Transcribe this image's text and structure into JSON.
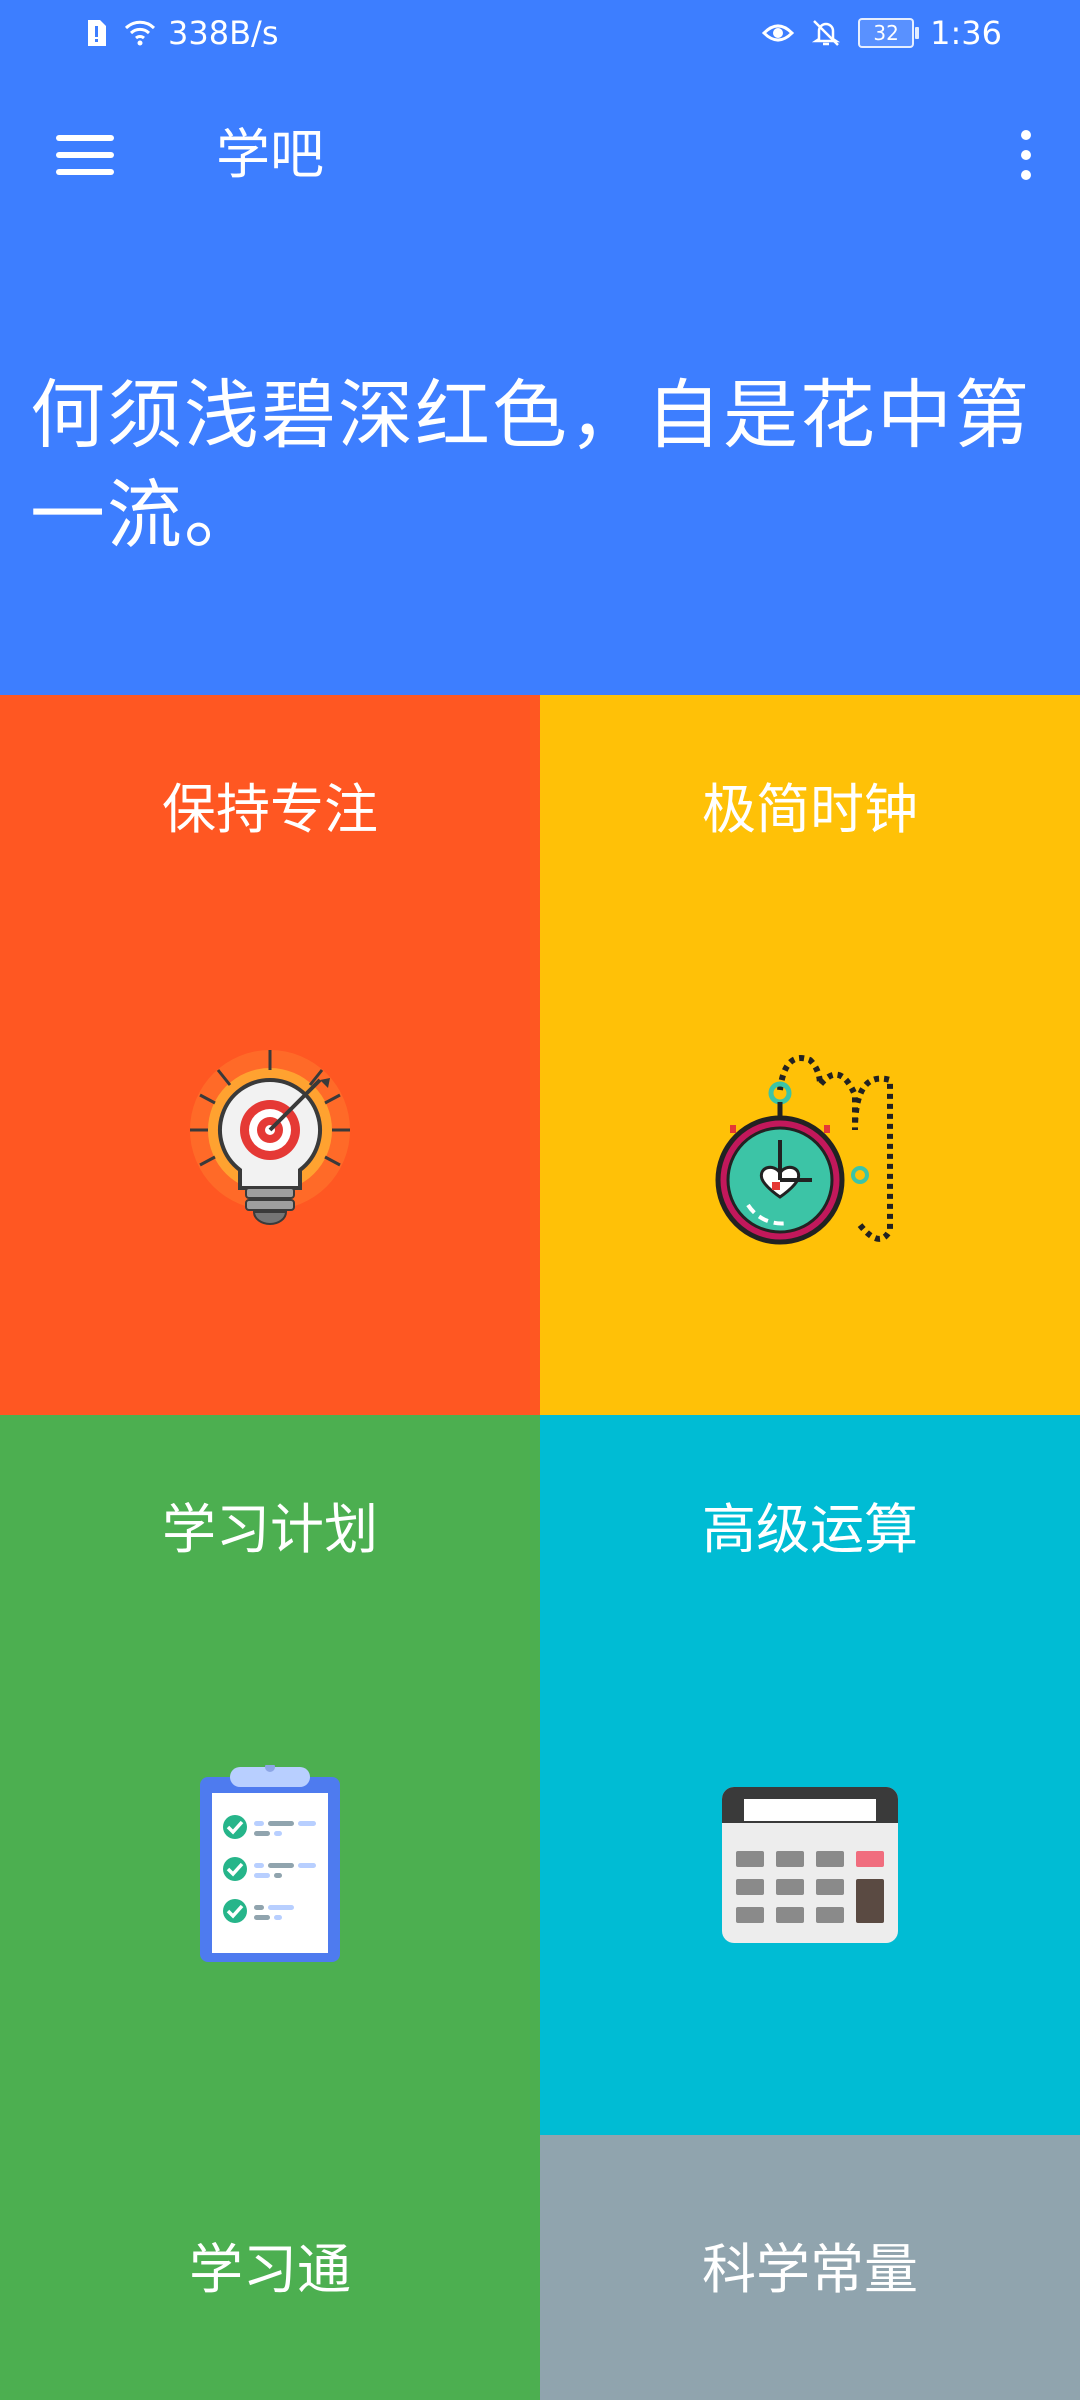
{
  "status_bar": {
    "net_speed": "338B/s",
    "battery": "32",
    "time": "1:36",
    "icons": [
      "sim-alert-icon",
      "wifi-icon",
      "eye-icon",
      "bell-off-icon"
    ]
  },
  "toolbar": {
    "title": "学吧",
    "menu_icon": "hamburger-menu-icon",
    "more_icon": "more-vert-icon"
  },
  "quote": "何须浅碧深红色，自是花中第一流。",
  "tiles": [
    {
      "label": "保持专注",
      "icon": "focus-lightbulb-target-icon",
      "color": "#FF5722"
    },
    {
      "label": "极简时钟",
      "icon": "stopwatch-heart-icon",
      "color": "#FFC107"
    },
    {
      "label": "学习计划",
      "icon": "clipboard-checklist-icon",
      "color": "#4CAF50"
    },
    {
      "label": "高级运算",
      "icon": "calculator-icon",
      "color": "#00BCD4"
    },
    {
      "label": "学习通",
      "color": "#4CAF50"
    },
    {
      "label": "科学常量",
      "color": "#90A4AE"
    }
  ],
  "colors": {
    "header": "#3D7EFF"
  }
}
